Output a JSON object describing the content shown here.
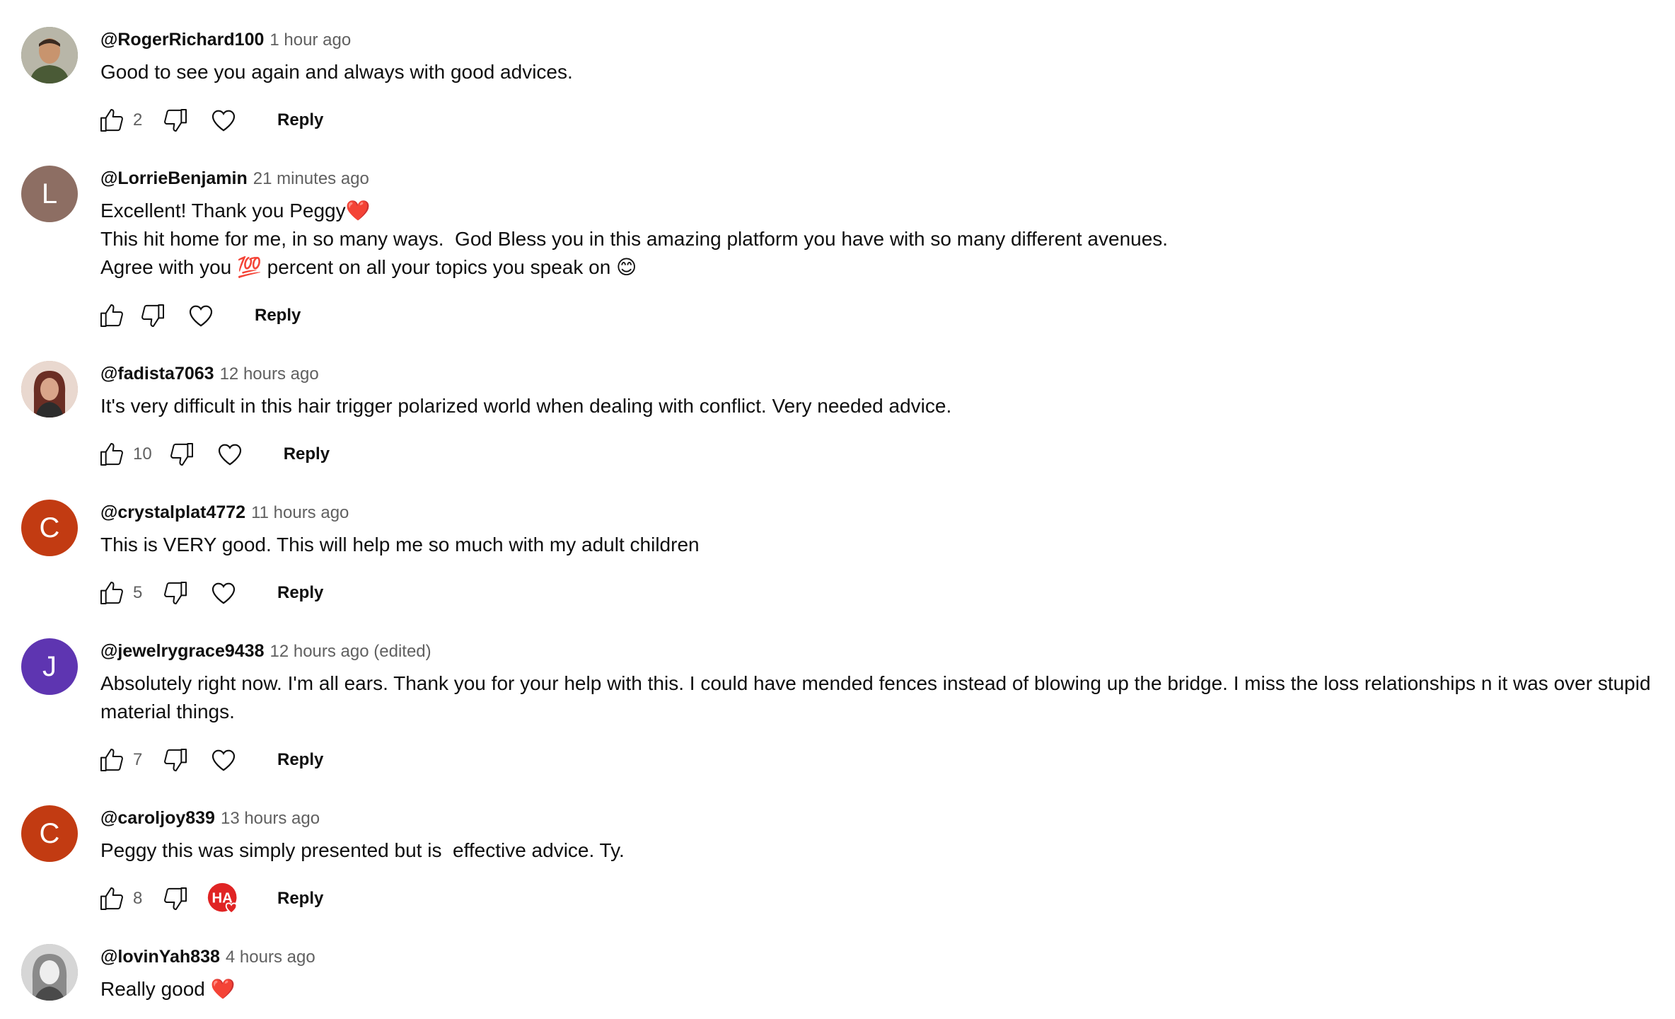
{
  "comments": [
    {
      "author": "@RogerRichard100",
      "time": "1 hour ago",
      "lines": [
        "Good to see you again and always with good advices."
      ],
      "likes": "2",
      "avatar": {
        "type": "photo",
        "bg": "#6b7d5e"
      },
      "creator_heart": false,
      "reply_label": "Reply"
    },
    {
      "author": "@LorrieBenjamin",
      "time": "21 minutes ago",
      "lines": [
        "Excellent! Thank you Peggy❤️",
        "This hit home for me, in so many ways.  God Bless you in this amazing platform you have with so many different avenues.",
        "Agree with you 💯 percent on all your topics you speak on 😊"
      ],
      "likes": "",
      "avatar": {
        "type": "letter",
        "letter": "L",
        "bg": "#8d6e63"
      },
      "creator_heart": false,
      "reply_label": "Reply"
    },
    {
      "author": "@fadista7063",
      "time": "12 hours ago",
      "lines": [
        "It's very difficult in this hair trigger polarized world when dealing with conflict. Very needed advice."
      ],
      "likes": "10",
      "avatar": {
        "type": "photo",
        "bg": "#c9a38f"
      },
      "creator_heart": false,
      "reply_label": "Reply"
    },
    {
      "author": "@crystalplat4772",
      "time": "11 hours ago",
      "lines": [
        "This is VERY good. This will help me so much with my adult children"
      ],
      "likes": "5",
      "avatar": {
        "type": "letter",
        "letter": "C",
        "bg": "#c23b12"
      },
      "creator_heart": false,
      "reply_label": "Reply"
    },
    {
      "author": "@jewelrygrace9438",
      "time": "12 hours ago (edited)",
      "lines": [
        "Absolutely right now. I'm all ears. Thank you for your help with this. I could have mended fences instead of blowing up the bridge. I miss the loss relationships n it was over stupid",
        "material things."
      ],
      "likes": "7",
      "avatar": {
        "type": "letter",
        "letter": "J",
        "bg": "#5e35b1"
      },
      "creator_heart": false,
      "reply_label": "Reply"
    },
    {
      "author": "@caroljoy839",
      "time": "13 hours ago",
      "lines": [
        "Peggy this was simply presented but is  effective advice. Ty."
      ],
      "likes": "8",
      "avatar": {
        "type": "letter",
        "letter": "C",
        "bg": "#c23b12"
      },
      "creator_heart": true,
      "creator_initials": "HA",
      "reply_label": "Reply"
    },
    {
      "author": "@lovinYah838",
      "time": "4 hours ago",
      "lines": [
        "Really good ❤️"
      ],
      "likes": "",
      "avatar": {
        "type": "photo",
        "bg": "#9e9e9e"
      },
      "creator_heart": false,
      "reply_label": "Reply"
    }
  ],
  "colors": {
    "text": "#0f0f0f",
    "secondary": "#606060",
    "creator_heart_bg": "#e02424"
  }
}
